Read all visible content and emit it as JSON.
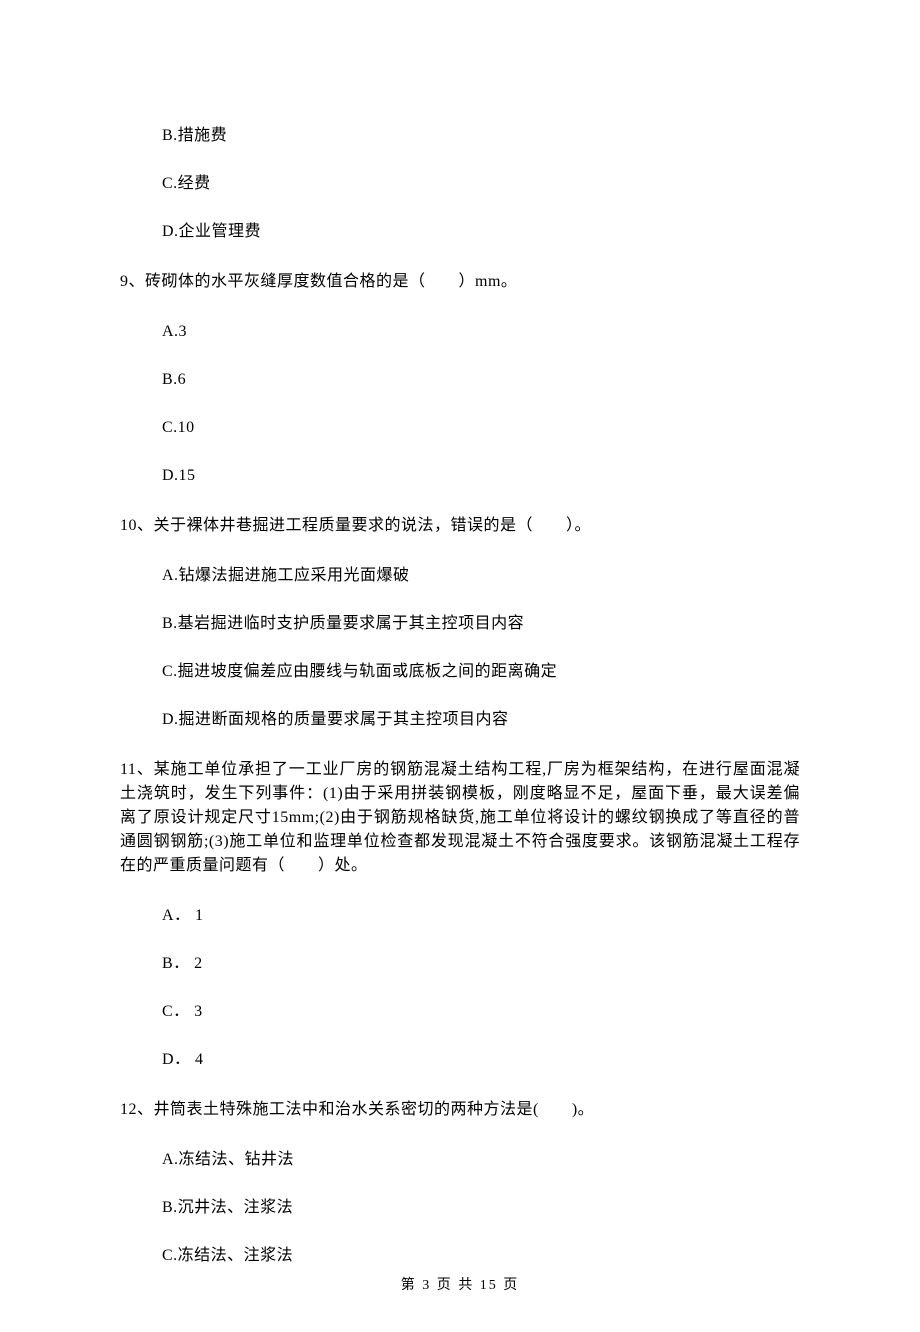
{
  "q8": {
    "opts": {
      "B": "B.措施费",
      "C": "C.经费",
      "D": "D.企业管理费"
    }
  },
  "q9": {
    "stem": "9、砖砌体的水平灰缝厚度数值合格的是（　　）mm。",
    "opts": {
      "A": "A.3",
      "B": "B.6",
      "C": "C.10",
      "D": "D.15"
    }
  },
  "q10": {
    "stem": "10、关于裸体井巷掘进工程质量要求的说法，错误的是（　　）。",
    "opts": {
      "A": "A.钻爆法掘进施工应采用光面爆破",
      "B": "B.基岩掘进临时支护质量要求属于其主控项目内容",
      "C": "C.掘进坡度偏差应由腰线与轨面或底板之间的距离确定",
      "D": "D.掘进断面规格的质量要求属于其主控项目内容"
    }
  },
  "q11": {
    "stem": "11、某施工单位承担了一工业厂房的钢筋混凝土结构工程,厂房为框架结构，在进行屋面混凝土浇筑时，发生下列事件：(1)由于采用拼装钢模板，刚度略显不足，屋面下垂，最大误差偏离了原设计规定尺寸15mm;(2)由于钢筋规格缺货,施工单位将设计的螺纹钢换成了等直径的普通圆钢钢筋;(3)施工单位和监理单位检查都发现混凝土不符合强度要求。该钢筋混凝土工程存在的严重质量问题有（　　）处。",
    "opts": {
      "A": "A． 1",
      "B": "B． 2",
      "C": "C． 3",
      "D": "D． 4"
    }
  },
  "q12": {
    "stem": "12、井筒表土特殊施工法中和治水关系密切的两种方法是(　　)。",
    "opts": {
      "A": "A.冻结法、钻井法",
      "B": "B.沉井法、注浆法",
      "C": "C.冻结法、注浆法"
    }
  },
  "footer": "第 3 页 共 15 页"
}
